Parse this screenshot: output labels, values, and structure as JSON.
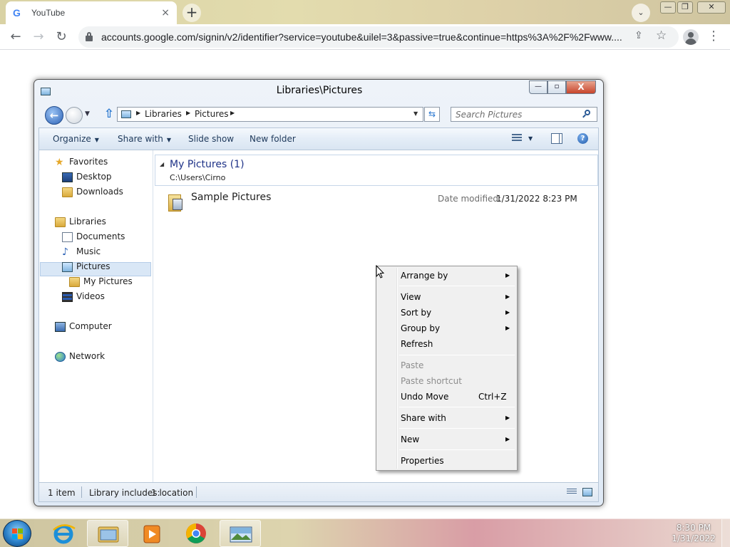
{
  "browser": {
    "tab_title": "YouTube",
    "tab_icon_letter": "G",
    "tab_close": "×",
    "new_tab": "+",
    "tab_search": "⌄",
    "url": "accounts.google.com/signin/v2/identifier?service=youtube&uilel=3&passive=true&continue=https%3A%2F%2Fwww....",
    "back": "←",
    "forward": "→",
    "reload": "↻",
    "share": "⇪",
    "star": "☆",
    "menu": "⋮",
    "win_min": "—",
    "win_max": "❐",
    "win_close": "✕"
  },
  "explorer": {
    "title": "Libraries\\Pictures",
    "address": {
      "crumbs": [
        "Libraries",
        "Pictures"
      ],
      "arrow": "▶",
      "dropdown": "▼"
    },
    "search_placeholder": "Search Pictures",
    "nav_back": "←",
    "nav_recent": "▼",
    "nav_up": "⇧",
    "refresh": "⇆",
    "help": "?",
    "commands": {
      "organize": "Organize",
      "share_with": "Share with",
      "slide_show": "Slide show",
      "new_folder": "New folder",
      "caret": "▼"
    },
    "nav_pane": {
      "favorites": "Favorites",
      "desktop": "Desktop",
      "downloads": "Downloads",
      "libraries": "Libraries",
      "documents": "Documents",
      "music": "Music",
      "pictures": "Pictures",
      "my_pictures": "My Pictures",
      "videos": "Videos",
      "computer": "Computer",
      "network": "Network",
      "star_glyph": "★",
      "note_glyph": "♪"
    },
    "library": {
      "collapse": "◢",
      "title": "My Pictures (1)",
      "path": "C:\\Users\\Cirno"
    },
    "items": [
      {
        "name": "Sample Pictures",
        "date_label": "Date modified:",
        "date_value": "1/31/2022 8:23 PM"
      }
    ],
    "status": {
      "count": "1 item",
      "library_includes": "Library includes:",
      "locations": "1 location"
    },
    "window_controls": {
      "min": "—",
      "max": "▫",
      "close": "X"
    }
  },
  "context_menu": {
    "submenu_arrow": "▶",
    "items": [
      {
        "label": "Arrange by"
      },
      {
        "label": "View"
      },
      {
        "label": "Sort by"
      },
      {
        "label": "Group by"
      },
      {
        "label": "Refresh"
      },
      {
        "label": "Paste"
      },
      {
        "label": "Paste shortcut"
      },
      {
        "label": "Undo Move",
        "shortcut": "Ctrl+Z"
      },
      {
        "label": "Share with"
      },
      {
        "label": "New"
      },
      {
        "label": "Properties"
      }
    ]
  },
  "taskbar": {
    "time": "8:30 PM",
    "date": "1/31/2022"
  },
  "colors": {
    "explorer_link": "#1e3287",
    "command_text": "#1e395b",
    "disabled_text": "#8d8d8d"
  }
}
